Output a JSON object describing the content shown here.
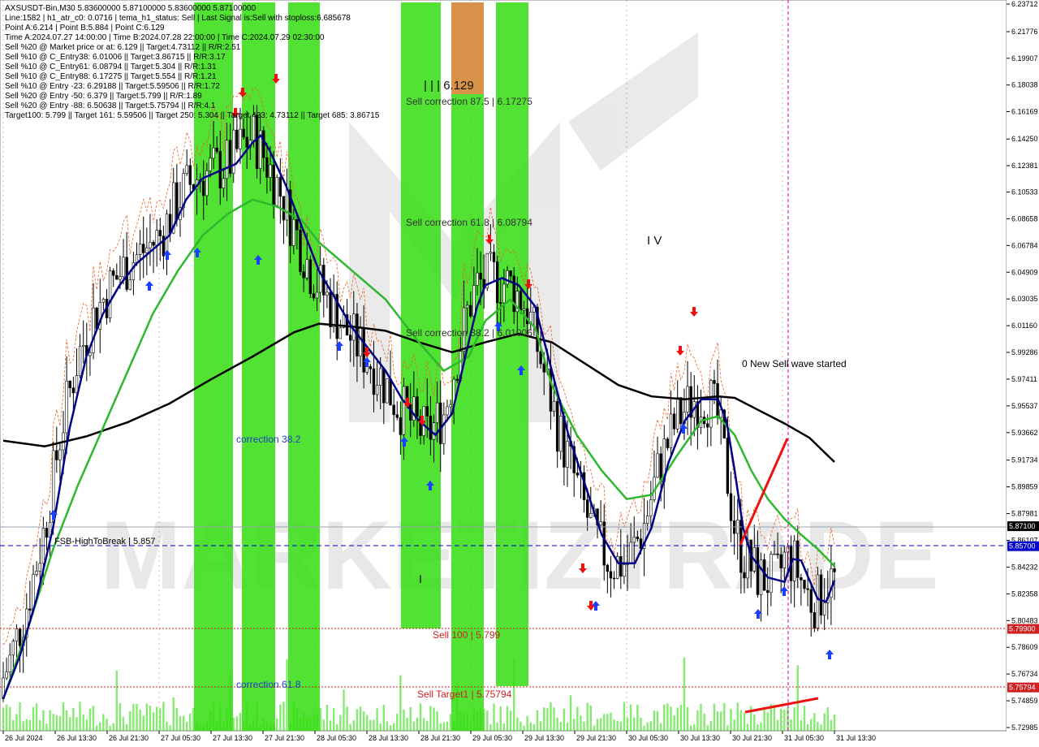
{
  "info_lines": [
    "AXSUSDT-Bin,M30  5.83600000 5.87100000 5.83600000 5.87100000",
    "Line:1582 | h1_atr_c0: 0.0716 | tema_h1_status: Sell | Last Signal is:Sell with stoploss:6.685678",
    "Point A:6.214 | Point B:5.884 | Point C:6.129",
    "Time A:2024.07.27 14:00:00 | Time B:2024.07.28 22:00:00 | Time C:2024.07.29 02:30:00",
    "Sell %20 @ Market price or at: 6.129 || Target:4.73112 || R/R:2.51",
    "Sell %10 @ C_Entry38: 6.01006 || Target:3.86715 || R/R:3.17",
    "Sell %10 @ C_Entry61: 6.08794 || Target:5.304 || R/R:1.31",
    "Sell %10 @ C_Entry88: 6.17275 || Target:5.554 || R/R:1.21",
    "Sell %10 @ Entry -23: 6.29188 || Target:5.59506 || R/R:1.72",
    "Sell %20 @ Entry -50: 6.379 || Target:5.799 || R/R:1.89",
    "Sell %20 @ Entry -88: 6.50638 || Target:5.75794 || R/R:4.1",
    "Target100: 5.799 || Target 161: 5.59506 || Target 250: 5.304 || Target 423: 4.73112 || Target 685: 3.86715"
  ],
  "annotations": {
    "point_c": "| | | 6.129",
    "sell_correction_875": "Sell correction 87.5 | 6.17275",
    "sell_correction_618": "Sell correction 61.8 | 6.08794",
    "sell_correction_382": "Sell correction 38.2 | 6.01006",
    "wave_iv": "I V",
    "new_sell_wave": "0 New Sell wave started",
    "correction_382": "correction 38.2",
    "correction_618": "correction 61.8",
    "fsb_label": "FSB-HighToBreak | 5.857",
    "sell_100": "Sell 100 | 5.799",
    "sell_target1": "Sell Target1 | 5.75794",
    "wave_i": "I",
    "watermark": "MARKETIZTRADE"
  },
  "colors": {
    "green_zone": "#33dd11",
    "orange_zone": "#d9924a",
    "ma_black": "#000000",
    "ma_navy": "#00008b",
    "ma_green": "#2db82d",
    "dashed_blue": "#0000cc",
    "red_line": "#cc2222",
    "magenta_line": "#cc00aa"
  },
  "chart_data": {
    "type": "line",
    "symbol": "AXSUSDT-Bin,M30",
    "ylim": [
      5.72985,
      6.23712
    ],
    "y_ticks": [
      "6.23712",
      "6.21776",
      "6.19907",
      "6.18038",
      "6.16169",
      "6.14250",
      "6.12381",
      "6.10533",
      "6.08658",
      "6.06784",
      "6.04909",
      "6.03035",
      "6.01160",
      "5.99286",
      "5.97411",
      "5.95537",
      "5.93662",
      "5.91734",
      "5.89859",
      "5.87981",
      "5.86107",
      "5.84232",
      "5.82358",
      "5.80483",
      "5.78609",
      "5.76734",
      "5.74859",
      "5.72985"
    ],
    "x_ticks": [
      "26 Jul 2024",
      "26 Jul 13:30",
      "26 Jul 21:30",
      "27 Jul 05:30",
      "27 Jul 13:30",
      "27 Jul 21:30",
      "28 Jul 05:30",
      "28 Jul 13:30",
      "28 Jul 21:30",
      "29 Jul 05:30",
      "29 Jul 13:30",
      "29 Jul 21:30",
      "30 Jul 05:30",
      "30 Jul 13:30",
      "30 Jul 21:30",
      "31 Jul 05:30",
      "31 Jul 13:30"
    ],
    "price_tags": [
      {
        "label": "5.87100",
        "value": 5.871,
        "color": "#000000"
      },
      {
        "label": "5.85700",
        "value": 5.857,
        "color": "#0000cc"
      },
      {
        "label": "5.79900",
        "value": 5.799,
        "color": "#cc2222"
      },
      {
        "label": "5.75794",
        "value": 5.75794,
        "color": "#cc2222"
      }
    ],
    "horizontal_levels": {
      "fsb": 5.857,
      "sell_100": 5.799,
      "sell_target1": 5.75794,
      "last": 5.871
    },
    "series": [
      {
        "name": "ma_slow",
        "points": [
          [
            0,
            5.931
          ],
          [
            0.05,
            5.927
          ],
          [
            0.1,
            5.934
          ],
          [
            0.15,
            5.944
          ],
          [
            0.2,
            5.957
          ],
          [
            0.25,
            5.974
          ],
          [
            0.3,
            5.99
          ],
          [
            0.35,
            6.007
          ],
          [
            0.38,
            6.013
          ],
          [
            0.42,
            6.011
          ],
          [
            0.46,
            6.008
          ],
          [
            0.5,
            6.0
          ],
          [
            0.54,
            5.993
          ],
          [
            0.58,
            6.0
          ],
          [
            0.62,
            6.006
          ],
          [
            0.66,
            6.0
          ],
          [
            0.7,
            5.985
          ],
          [
            0.74,
            5.97
          ],
          [
            0.78,
            5.962
          ],
          [
            0.82,
            5.96
          ],
          [
            0.86,
            5.962
          ],
          [
            0.88,
            5.961
          ],
          [
            0.91,
            5.952
          ],
          [
            0.94,
            5.943
          ],
          [
            0.97,
            5.933
          ],
          [
            1.0,
            5.916
          ]
        ]
      },
      {
        "name": "ma_mid",
        "points": [
          [
            0,
            5.75
          ],
          [
            0.03,
            5.8
          ],
          [
            0.06,
            5.855
          ],
          [
            0.09,
            5.9
          ],
          [
            0.12,
            5.94
          ],
          [
            0.15,
            5.98
          ],
          [
            0.18,
            6.02
          ],
          [
            0.21,
            6.05
          ],
          [
            0.24,
            6.075
          ],
          [
            0.27,
            6.09
          ],
          [
            0.3,
            6.1
          ],
          [
            0.33,
            6.095
          ],
          [
            0.36,
            6.085
          ],
          [
            0.38,
            6.07
          ],
          [
            0.42,
            6.05
          ],
          [
            0.46,
            6.03
          ],
          [
            0.5,
            6.0
          ],
          [
            0.53,
            5.98
          ],
          [
            0.56,
            5.99
          ],
          [
            0.58,
            6.015
          ],
          [
            0.61,
            6.03
          ],
          [
            0.64,
            6.01
          ],
          [
            0.66,
            5.97
          ],
          [
            0.69,
            5.935
          ],
          [
            0.72,
            5.91
          ],
          [
            0.75,
            5.89
          ],
          [
            0.78,
            5.893
          ],
          [
            0.81,
            5.92
          ],
          [
            0.84,
            5.945
          ],
          [
            0.86,
            5.948
          ],
          [
            0.88,
            5.935
          ],
          [
            0.9,
            5.91
          ],
          [
            0.92,
            5.89
          ],
          [
            0.94,
            5.876
          ],
          [
            0.96,
            5.865
          ],
          [
            0.98,
            5.855
          ],
          [
            1.0,
            5.843
          ]
        ]
      },
      {
        "name": "ma_fast",
        "points": [
          [
            0,
            5.75
          ],
          [
            0.02,
            5.78
          ],
          [
            0.04,
            5.82
          ],
          [
            0.06,
            5.87
          ],
          [
            0.08,
            5.94
          ],
          [
            0.1,
            5.99
          ],
          [
            0.12,
            6.02
          ],
          [
            0.14,
            6.04
          ],
          [
            0.16,
            6.055
          ],
          [
            0.18,
            6.065
          ],
          [
            0.2,
            6.075
          ],
          [
            0.22,
            6.1
          ],
          [
            0.24,
            6.115
          ],
          [
            0.26,
            6.12
          ],
          [
            0.28,
            6.125
          ],
          [
            0.3,
            6.14
          ],
          [
            0.31,
            6.145
          ],
          [
            0.32,
            6.135
          ],
          [
            0.34,
            6.11
          ],
          [
            0.36,
            6.08
          ],
          [
            0.38,
            6.05
          ],
          [
            0.4,
            6.03
          ],
          [
            0.42,
            6.01
          ],
          [
            0.44,
            5.995
          ],
          [
            0.46,
            5.98
          ],
          [
            0.48,
            5.96
          ],
          [
            0.5,
            5.945
          ],
          [
            0.52,
            5.935
          ],
          [
            0.54,
            5.95
          ],
          [
            0.56,
            6.0
          ],
          [
            0.57,
            6.025
          ],
          [
            0.58,
            6.04
          ],
          [
            0.6,
            6.045
          ],
          [
            0.62,
            6.04
          ],
          [
            0.64,
            6.025
          ],
          [
            0.66,
            5.98
          ],
          [
            0.68,
            5.935
          ],
          [
            0.7,
            5.9
          ],
          [
            0.72,
            5.865
          ],
          [
            0.74,
            5.845
          ],
          [
            0.76,
            5.845
          ],
          [
            0.78,
            5.87
          ],
          [
            0.8,
            5.915
          ],
          [
            0.82,
            5.945
          ],
          [
            0.84,
            5.96
          ],
          [
            0.86,
            5.96
          ],
          [
            0.87,
            5.945
          ],
          [
            0.88,
            5.91
          ],
          [
            0.89,
            5.87
          ],
          [
            0.9,
            5.85
          ],
          [
            0.92,
            5.835
          ],
          [
            0.94,
            5.832
          ],
          [
            0.95,
            5.848
          ],
          [
            0.96,
            5.847
          ],
          [
            0.97,
            5.833
          ],
          [
            0.98,
            5.82
          ],
          [
            0.99,
            5.818
          ],
          [
            1.0,
            5.833
          ]
        ]
      }
    ]
  }
}
